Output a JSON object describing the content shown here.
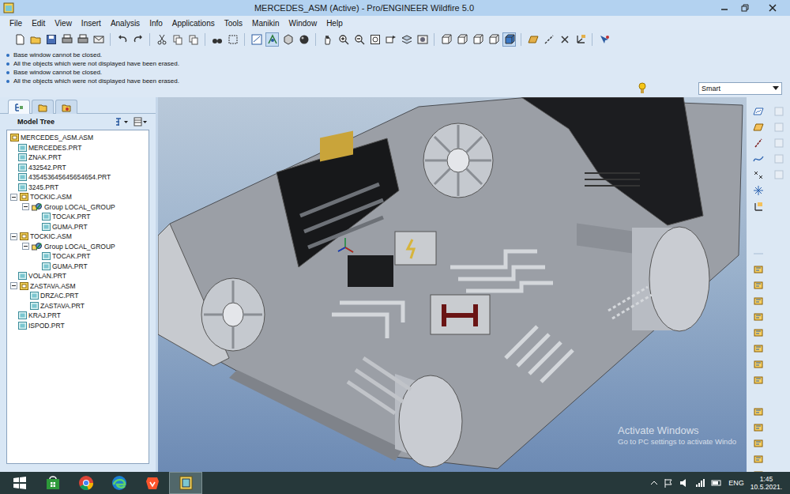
{
  "window": {
    "title": "MERCEDES_ASM (Active) - Pro/ENGINEER Wildfire 5.0"
  },
  "menu": [
    "File",
    "Edit",
    "View",
    "Insert",
    "Analysis",
    "Info",
    "Applications",
    "Tools",
    "Manikin",
    "Window",
    "Help"
  ],
  "messages": [
    "Base window cannot be closed.",
    "All the objects which were not displayed have been erased.",
    "Base window cannot be closed.",
    "All the objects which were not displayed have been erased."
  ],
  "selection_filter": {
    "value": "Smart"
  },
  "model_tree": {
    "title": "Model Tree",
    "tabs": [
      {
        "selected": true
      },
      {
        "selected": false
      },
      {
        "selected": false
      }
    ],
    "items": [
      {
        "label": "MERCEDES_ASM.ASM",
        "level": 0,
        "kind": "asm",
        "expanded": true
      },
      {
        "label": "MERCEDES.PRT",
        "level": 1,
        "kind": "prt",
        "expanded": false
      },
      {
        "label": "ZNAK.PRT",
        "level": 1,
        "kind": "prt",
        "expanded": false
      },
      {
        "label": "432542.PRT",
        "level": 1,
        "kind": "prt",
        "expanded": false
      },
      {
        "label": "435453645645654654.PRT",
        "level": 1,
        "kind": "prt",
        "expanded": false
      },
      {
        "label": "3245.PRT",
        "level": 1,
        "kind": "prt",
        "expanded": false
      },
      {
        "label": "TOCKIC.ASM",
        "level": 1,
        "kind": "asm",
        "expanded": true
      },
      {
        "label": "Group LOCAL_GROUP",
        "level": 2,
        "kind": "group",
        "expanded": true
      },
      {
        "label": "TOCAK.PRT",
        "level": 3,
        "kind": "prt",
        "expanded": false
      },
      {
        "label": "GUMA.PRT",
        "level": 3,
        "kind": "prt",
        "expanded": false
      },
      {
        "label": "TOCKIC.ASM",
        "level": 1,
        "kind": "asm",
        "expanded": true
      },
      {
        "label": "Group LOCAL_GROUP",
        "level": 2,
        "kind": "group",
        "expanded": true
      },
      {
        "label": "TOCAK.PRT",
        "level": 3,
        "kind": "prt",
        "expanded": false
      },
      {
        "label": "GUMA.PRT",
        "level": 3,
        "kind": "prt",
        "expanded": false
      },
      {
        "label": "VOLAN.PRT",
        "level": 1,
        "kind": "prt",
        "expanded": false
      },
      {
        "label": "ZASTAVA.ASM",
        "level": 1,
        "kind": "asm",
        "expanded": true
      },
      {
        "label": "DRZAC.PRT",
        "level": 2,
        "kind": "prt",
        "expanded": false
      },
      {
        "label": "ZASTAVA.PRT",
        "level": 2,
        "kind": "prt",
        "expanded": false
      },
      {
        "label": "KRAJ.PRT",
        "level": 1,
        "kind": "prt",
        "expanded": false
      },
      {
        "label": "ISPOD.PRT",
        "level": 1,
        "kind": "prt",
        "expanded": false
      }
    ]
  },
  "watermark": {
    "title": "Activate Windows",
    "subtitle": "Go to PC settings to activate Windo"
  },
  "taskbar": {
    "apps": [
      {
        "kind": "store",
        "selected": false
      },
      {
        "kind": "chrome",
        "selected": false
      },
      {
        "kind": "edge",
        "selected": false
      },
      {
        "kind": "brave",
        "selected": false
      },
      {
        "kind": "proe",
        "selected": true
      }
    ],
    "language": "ENG",
    "time": "1:45",
    "date": "10.5.2021."
  }
}
